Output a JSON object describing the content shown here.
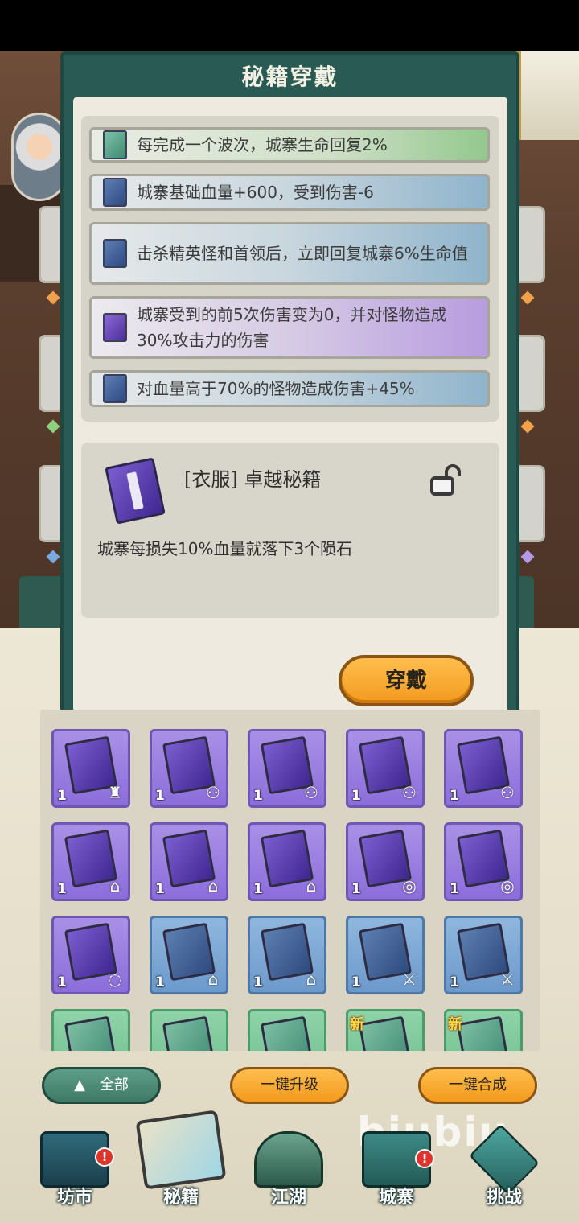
{
  "modal": {
    "title": "秘籍穿戴",
    "bonuses": [
      {
        "text": "每完成一个波次，城寨生命回复2%",
        "rarity": "green"
      },
      {
        "text": "城寨基础血量+600，受到伤害-6",
        "rarity": "blue"
      },
      {
        "text": "击杀精英怪和首领后，立即回复城寨6%生命值",
        "rarity": "blue"
      },
      {
        "text": "城寨受到的前5次伤害变为0，并对怪物造成30%攻击力的伤害",
        "rarity": "purple"
      },
      {
        "text": "对血量高于70%的怪物造成伤害+45%",
        "rarity": "blue"
      }
    ],
    "detail": {
      "title": "[衣服] 卓越秘籍",
      "description": "城寨每损失10%血量就落下3个陨石",
      "lock_icon": "unlock-icon"
    },
    "equip_label": "穿戴"
  },
  "inventory": {
    "rows": [
      [
        {
          "rarity": "purple",
          "count": "1",
          "slot": "armor-icon"
        },
        {
          "rarity": "purple",
          "count": "1",
          "slot": "robe-icon"
        },
        {
          "rarity": "purple",
          "count": "1",
          "slot": "robe-icon"
        },
        {
          "rarity": "purple",
          "count": "1",
          "slot": "robe-icon"
        },
        {
          "rarity": "purple",
          "count": "1",
          "slot": "robe-icon"
        }
      ],
      [
        {
          "rarity": "purple",
          "count": "1",
          "slot": "boots-icon"
        },
        {
          "rarity": "purple",
          "count": "1",
          "slot": "boots-icon"
        },
        {
          "rarity": "purple",
          "count": "1",
          "slot": "boots-icon"
        },
        {
          "rarity": "purple",
          "count": "1",
          "slot": "ring-icon"
        },
        {
          "rarity": "purple",
          "count": "1",
          "slot": "ring-icon"
        }
      ],
      [
        {
          "rarity": "purple",
          "count": "1",
          "slot": "necklace-icon"
        },
        {
          "rarity": "blue",
          "count": "1",
          "slot": "boots-icon"
        },
        {
          "rarity": "blue",
          "count": "1",
          "slot": "boots-icon"
        },
        {
          "rarity": "blue",
          "count": "1",
          "slot": "sword-icon"
        },
        {
          "rarity": "blue",
          "count": "1",
          "slot": "sword-icon"
        }
      ],
      [
        {
          "rarity": "green",
          "count": "",
          "slot": ""
        },
        {
          "rarity": "green",
          "count": "",
          "slot": ""
        },
        {
          "rarity": "green",
          "count": "",
          "slot": ""
        },
        {
          "rarity": "green",
          "count": "",
          "slot": "",
          "new": "新"
        },
        {
          "rarity": "green",
          "count": "",
          "slot": "",
          "new": "新"
        }
      ]
    ]
  },
  "actions": {
    "filter_label": "全部",
    "upgrade_all_label": "一键升级",
    "merge_all_label": "一键合成"
  },
  "nav": [
    {
      "label": "坊市",
      "icon": "market-icon",
      "alert": "!"
    },
    {
      "label": "秘籍",
      "icon": "manual-icon",
      "alert": ""
    },
    {
      "label": "江湖",
      "icon": "mountain-icon",
      "alert": ""
    },
    {
      "label": "城寨",
      "icon": "fortress-icon",
      "alert": "!"
    },
    {
      "label": "挑战",
      "icon": "swords-icon",
      "alert": ""
    }
  ],
  "watermark": "biubiu",
  "colors": {
    "modal_frame": "#2a5a54",
    "accent_orange": "#f29a1e",
    "rarity_green": "#8fd3a9",
    "rarity_blue": "#8fb7de",
    "rarity_purple": "#a990e6"
  }
}
